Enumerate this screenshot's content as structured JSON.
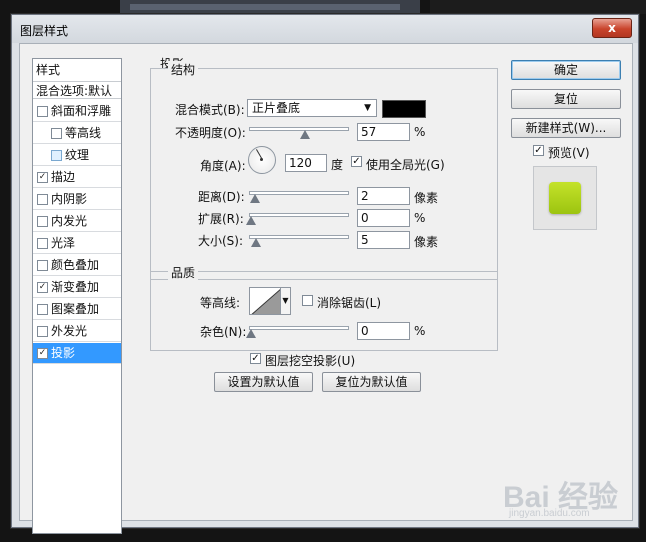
{
  "dialog": {
    "title": "图层样式",
    "close_label": "x"
  },
  "style_list": {
    "header": "样式",
    "blend_options": "混合选项:默认",
    "items": [
      {
        "label": "斜面和浮雕",
        "checked": false
      },
      {
        "label": "等高线",
        "checked": false
      },
      {
        "label": "纹理",
        "checked": false
      },
      {
        "label": "描边",
        "checked": true
      },
      {
        "label": "内阴影",
        "checked": false
      },
      {
        "label": "内发光",
        "checked": false
      },
      {
        "label": "光泽",
        "checked": false
      },
      {
        "label": "颜色叠加",
        "checked": false
      },
      {
        "label": "渐变叠加",
        "checked": true
      },
      {
        "label": "图案叠加",
        "checked": false
      },
      {
        "label": "外发光",
        "checked": false
      },
      {
        "label": "投影",
        "checked": true,
        "selected": true
      }
    ]
  },
  "drop_shadow": {
    "section_title": "投影",
    "structure": {
      "title": "结构",
      "blend_mode_label": "混合模式(B):",
      "blend_mode_value": "正片叠底",
      "blend_color": "#000000",
      "opacity_label": "不透明度(O):",
      "opacity_value": "57",
      "opacity_unit": "%",
      "angle_label": "角度(A):",
      "angle_value": "120",
      "angle_unit": "度",
      "global_light_label": "使用全局光(G)",
      "global_light_checked": true,
      "distance_label": "距离(D):",
      "distance_value": "2",
      "distance_unit": "像素",
      "spread_label": "扩展(R):",
      "spread_value": "0",
      "spread_unit": "%",
      "size_label": "大小(S):",
      "size_value": "5",
      "size_unit": "像素"
    },
    "quality": {
      "title": "品质",
      "contour_label": "等高线:",
      "anti_alias_label": "消除锯齿(L)",
      "anti_alias_checked": false,
      "noise_label": "杂色(N):",
      "noise_value": "0",
      "noise_unit": "%"
    },
    "knockout_label": "图层挖空投影(U)",
    "knockout_checked": true,
    "make_default_label": "设置为默认值",
    "reset_default_label": "复位为默认值"
  },
  "right_panel": {
    "ok_label": "确定",
    "reset_label": "复位",
    "new_style_label": "新建样式(W)...",
    "preview_label": "预览(V)",
    "preview_checked": true,
    "preview_color": "#b4d41c"
  },
  "watermark": {
    "brand": "Bai 经验",
    "url": "jingyan.baidu.com"
  },
  "check_mark": "✓"
}
